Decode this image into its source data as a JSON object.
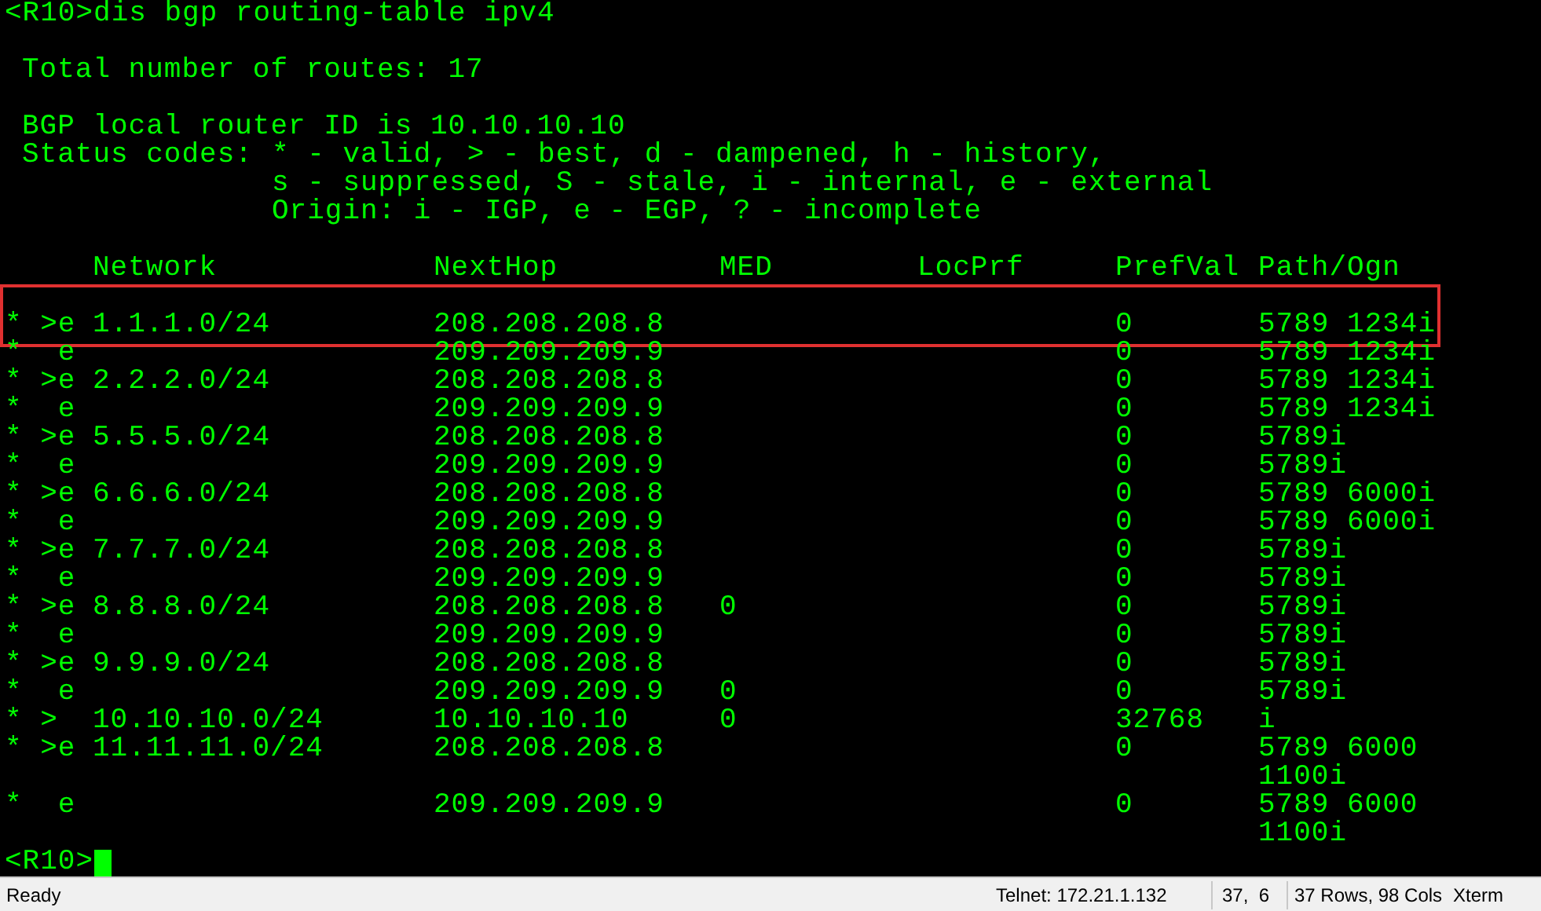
{
  "terminal": {
    "command_prompt": "<R10>",
    "command": "dis bgp routing-table ipv4",
    "total_routes": "Total number of routes: 17",
    "router_id": "BGP local router ID is 10.10.10.10",
    "status_codes": {
      "label": "Status codes:",
      "lines": [
        "* - valid, > - best, d - dampened, h - history,",
        "s - suppressed, S - stale, i - internal, e - external",
        "Origin: i - IGP, e - EGP, ? - incomplete"
      ]
    },
    "table": {
      "columns": [
        "Network",
        "NextHop",
        "MED",
        "LocPrf",
        "PrefVal",
        "Path/Ogn"
      ],
      "rows": [
        {
          "flags": "* >e",
          "network": "1.1.1.0/24",
          "next_hop": "208.208.208.8",
          "med": "",
          "locprf": "",
          "prefval": "0",
          "path": "5789 1234i",
          "highlighted": true
        },
        {
          "flags": "*  e",
          "network": "",
          "next_hop": "209.209.209.9",
          "med": "",
          "locprf": "",
          "prefval": "0",
          "path": "5789 1234i",
          "highlighted": false
        },
        {
          "flags": "* >e",
          "network": "2.2.2.0/24",
          "next_hop": "208.208.208.8",
          "med": "",
          "locprf": "",
          "prefval": "0",
          "path": "5789 1234i",
          "highlighted": false
        },
        {
          "flags": "*  e",
          "network": "",
          "next_hop": "209.209.209.9",
          "med": "",
          "locprf": "",
          "prefval": "0",
          "path": "5789 1234i",
          "highlighted": false
        },
        {
          "flags": "* >e",
          "network": "5.5.5.0/24",
          "next_hop": "208.208.208.8",
          "med": "",
          "locprf": "",
          "prefval": "0",
          "path": "5789i",
          "highlighted": false
        },
        {
          "flags": "*  e",
          "network": "",
          "next_hop": "209.209.209.9",
          "med": "",
          "locprf": "",
          "prefval": "0",
          "path": "5789i",
          "highlighted": false
        },
        {
          "flags": "* >e",
          "network": "6.6.6.0/24",
          "next_hop": "208.208.208.8",
          "med": "",
          "locprf": "",
          "prefval": "0",
          "path": "5789 6000i",
          "highlighted": false
        },
        {
          "flags": "*  e",
          "network": "",
          "next_hop": "209.209.209.9",
          "med": "",
          "locprf": "",
          "prefval": "0",
          "path": "5789 6000i",
          "highlighted": false
        },
        {
          "flags": "* >e",
          "network": "7.7.7.0/24",
          "next_hop": "208.208.208.8",
          "med": "",
          "locprf": "",
          "prefval": "0",
          "path": "5789i",
          "highlighted": false
        },
        {
          "flags": "*  e",
          "network": "",
          "next_hop": "209.209.209.9",
          "med": "",
          "locprf": "",
          "prefval": "0",
          "path": "5789i",
          "highlighted": false
        },
        {
          "flags": "* >e",
          "network": "8.8.8.0/24",
          "next_hop": "208.208.208.8",
          "med": "0",
          "locprf": "",
          "prefval": "0",
          "path": "5789i",
          "highlighted": false
        },
        {
          "flags": "*  e",
          "network": "",
          "next_hop": "209.209.209.9",
          "med": "",
          "locprf": "",
          "prefval": "0",
          "path": "5789i",
          "highlighted": false
        },
        {
          "flags": "* >e",
          "network": "9.9.9.0/24",
          "next_hop": "208.208.208.8",
          "med": "",
          "locprf": "",
          "prefval": "0",
          "path": "5789i",
          "highlighted": false
        },
        {
          "flags": "*  e",
          "network": "",
          "next_hop": "209.209.209.9",
          "med": "0",
          "locprf": "",
          "prefval": "0",
          "path": "5789i",
          "highlighted": false
        },
        {
          "flags": "* >",
          "network": "10.10.10.0/24",
          "next_hop": "10.10.10.10",
          "med": "0",
          "locprf": "",
          "prefval": "32768",
          "path": "i",
          "highlighted": false
        },
        {
          "flags": "* >e",
          "network": "11.11.11.0/24",
          "next_hop": "208.208.208.8",
          "med": "",
          "locprf": "",
          "prefval": "0",
          "path": "5789 6000 1100i",
          "highlighted": false
        },
        {
          "flags": "*  e",
          "network": "",
          "next_hop": "209.209.209.9",
          "med": "",
          "locprf": "",
          "prefval": "0",
          "path": "5789 6000 1100i",
          "highlighted": false
        }
      ]
    },
    "final_prompt": "<R10>"
  },
  "status_bar": {
    "state": "Ready",
    "connection": "Telnet: 172.21.1.132",
    "cursor_position": "37,  6",
    "size": "37 Rows, 98 Cols",
    "terminal_type": "Xterm"
  }
}
